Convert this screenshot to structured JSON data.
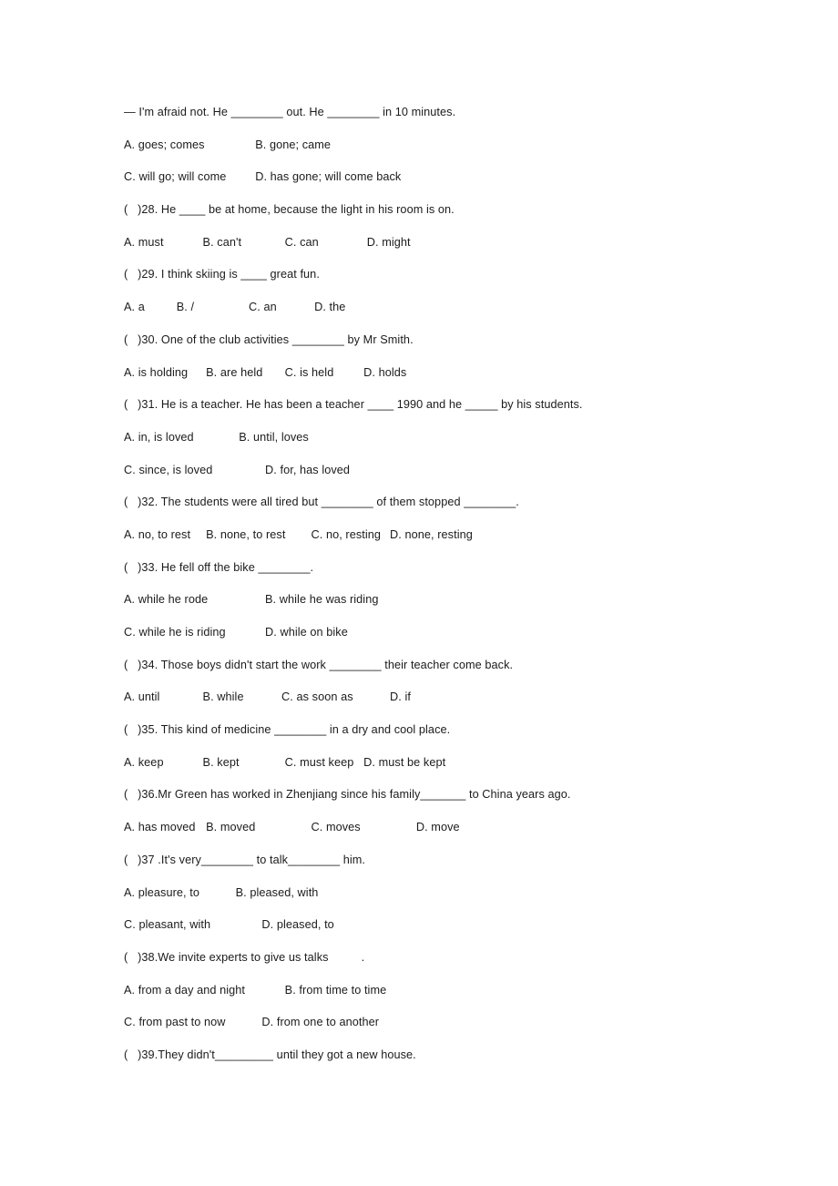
{
  "document": {
    "type": "english-grammar-multiple-choice-worksheet",
    "text_color": "#1b1b1b",
    "background_color": "#ffffff",
    "lines": [
      {
        "id": "stem-27-continuation",
        "kind": "question",
        "text": "— I'm afraid not. He ________ out. He ________ in 10 minutes."
      },
      {
        "id": "options-27-ab",
        "kind": "options",
        "text": "A. goes; comes\t\tB. gone; came"
      },
      {
        "id": "options-27-cd",
        "kind": "options",
        "text": "C. will go; will come\t\tD. has gone; will come back"
      },
      {
        "id": "question-28",
        "kind": "question",
        "text": "(   )28. He ____ be at home, because the light in his room is on."
      },
      {
        "id": "options-28",
        "kind": "options",
        "text": "A. must\t\tB. can't\t\t C. can\t\t  D. might"
      },
      {
        "id": "question-29",
        "kind": "question",
        "text": "(   )29. I think skiing is ____ great fun."
      },
      {
        "id": "options-29",
        "kind": "options",
        "text": "A. a\t\tB. /\t\t      C. an\t\t  D. the"
      },
      {
        "id": "question-30",
        "kind": "question",
        "text": "(   )30. One of the club activities ________ by Mr Smith."
      },
      {
        "id": "options-30",
        "kind": "options",
        "text": "A. is holding\t B. are held\t C. is held\t D. holds"
      },
      {
        "id": "question-31",
        "kind": "question",
        "text": "(   )31. He is a teacher. He has been a teacher ____ 1990 and he _____ by his students."
      },
      {
        "id": "options-31-ab",
        "kind": "options",
        "text": "A. in, is loved\t\t   B. until, loves"
      },
      {
        "id": "options-31-cd",
        "kind": "options",
        "text": "C. since, is loved\t\t   D. for, has loved"
      },
      {
        "id": "question-32",
        "kind": "question",
        "text": "(   )32. The students were all tired but ________ of them stopped ________."
      },
      {
        "id": "options-32",
        "kind": "options",
        "text": "A. no, to rest\t B. none, to rest\t C. no, resting\t D. none, resting"
      },
      {
        "id": "question-33",
        "kind": "question",
        "text": "(   )33. He fell off the bike ________."
      },
      {
        "id": "options-33-ab",
        "kind": "options",
        "text": "A. while he rode\t\t   B. while he was riding"
      },
      {
        "id": "options-33-cd",
        "kind": "options",
        "text": "C. while he is riding\t\t   D. while on bike"
      },
      {
        "id": "question-34",
        "kind": "question",
        "text": "(   )34. Those boys didn't start the work ________ their teacher come back."
      },
      {
        "id": "options-34",
        "kind": "options",
        "text": "A. until\t\tB. while\t\tC. as soon as\t\t D. if"
      },
      {
        "id": "question-35",
        "kind": "question",
        "text": "(   )35. This kind of medicine ________ in a dry and cool place."
      },
      {
        "id": "options-35",
        "kind": "options",
        "text": "A. keep\t\tB. kept\t\t C. must keep\t D. must be kept"
      },
      {
        "id": "question-36",
        "kind": "question",
        "text": "(   )36.Mr Green has worked in Zhenjiang since his family_______ to China years ago."
      },
      {
        "id": "options-36",
        "kind": "options",
        "text": "A. has moved\t B. moved\t\t C. moves\t\t D. move"
      },
      {
        "id": "question-37",
        "kind": "question",
        "text": "(   )37 .It's very________ to talk________ him."
      },
      {
        "id": "options-37-ab",
        "kind": "options",
        "text": "A. pleasure, to\t\t  B. pleased, with"
      },
      {
        "id": "options-37-cd",
        "kind": "options",
        "text": "C. pleasant, with\t\t  D. pleased, to"
      },
      {
        "id": "question-38",
        "kind": "question",
        "text": "(   )38.We invite experts to give us talks          ."
      },
      {
        "id": "options-38-ab",
        "kind": "options",
        "text": "A. from a day and night\t\t B. from time to time"
      },
      {
        "id": "options-38-cd",
        "kind": "options",
        "text": "C. from past to now\t\t  D. from one to another"
      },
      {
        "id": "question-39",
        "kind": "question",
        "text": "(   )39.They didn't_________ until they got a new house."
      }
    ]
  }
}
